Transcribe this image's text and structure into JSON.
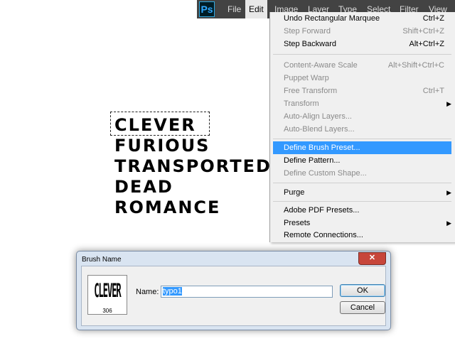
{
  "canvas": {
    "words": [
      "CLEVER",
      "FURIOUS",
      "TRANSPORTED",
      "DEAD",
      "ROMANCE"
    ]
  },
  "menubar": {
    "logo": "Ps",
    "items": [
      "File",
      "Edit",
      "Image",
      "Layer",
      "Type",
      "Select",
      "Filter",
      "View"
    ],
    "active": "Edit"
  },
  "edit_menu": {
    "items": [
      {
        "label": "Undo Rectangular Marquee",
        "shortcut": "Ctrl+Z",
        "state": "enabled"
      },
      {
        "label": "Step Forward",
        "shortcut": "Shift+Ctrl+Z",
        "state": "disabled"
      },
      {
        "label": "Step Backward",
        "shortcut": "Alt+Ctrl+Z",
        "state": "enabled"
      },
      {
        "label": "Content-Aware Scale",
        "shortcut": "Alt+Shift+Ctrl+C",
        "state": "disabled"
      },
      {
        "label": "Puppet Warp",
        "shortcut": "",
        "state": "disabled"
      },
      {
        "label": "Free Transform",
        "shortcut": "Ctrl+T",
        "state": "disabled"
      },
      {
        "label": "Transform",
        "shortcut": "",
        "state": "disabled",
        "submenu": true
      },
      {
        "label": "Auto-Align Layers...",
        "shortcut": "",
        "state": "disabled"
      },
      {
        "label": "Auto-Blend Layers...",
        "shortcut": "",
        "state": "disabled"
      },
      {
        "label": "Define Brush Preset...",
        "shortcut": "",
        "state": "highlighted"
      },
      {
        "label": "Define Pattern...",
        "shortcut": "",
        "state": "enabled"
      },
      {
        "label": "Define Custom Shape...",
        "shortcut": "",
        "state": "disabled"
      },
      {
        "label": "Purge",
        "shortcut": "",
        "state": "enabled",
        "submenu": true
      },
      {
        "label": "Adobe PDF Presets...",
        "shortcut": "",
        "state": "enabled"
      },
      {
        "label": "Presets",
        "shortcut": "",
        "state": "enabled",
        "submenu": true
      },
      {
        "label": "Remote Connections...",
        "shortcut": "",
        "state": "enabled"
      }
    ]
  },
  "dialog": {
    "title": "Brush Name",
    "close_glyph": "✕",
    "preview_word": "CLEVER",
    "preview_size": "306",
    "name_label": "Name:",
    "name_value": "typo1",
    "ok_label": "OK",
    "cancel_label": "Cancel"
  }
}
